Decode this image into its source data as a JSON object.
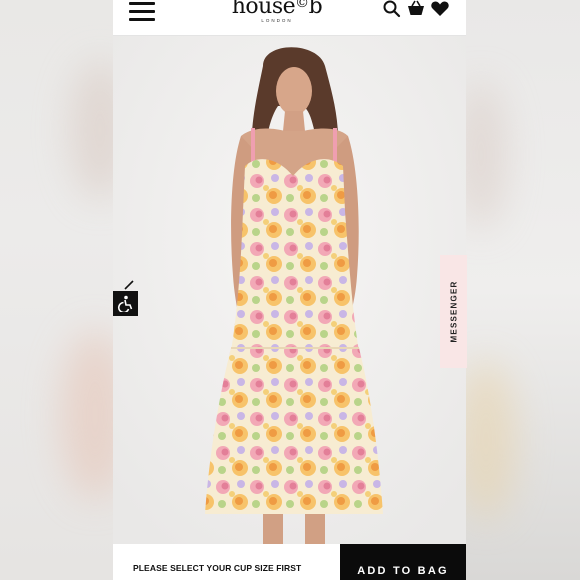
{
  "header": {
    "logo_text": "house",
    "logo_ampersand": "©",
    "logo_suffix": "b",
    "logo_sub": "LONDON",
    "icons": [
      "menu-icon",
      "search-icon",
      "basket-icon",
      "heart-icon"
    ]
  },
  "product": {
    "image": "model wearing floral corset midi dress with tiered hem"
  },
  "messenger": {
    "label": "MESSENGER"
  },
  "bottom_bar": {
    "cup_message": "PLEASE SELECT YOUR CUP SIZE FIRST",
    "add_to_bag_label": "ADD TO BAG"
  },
  "colors": {
    "brand_black": "#0b0b0b",
    "messenger_bg": "#f9e6e6",
    "page_bg": "#f0efee"
  }
}
